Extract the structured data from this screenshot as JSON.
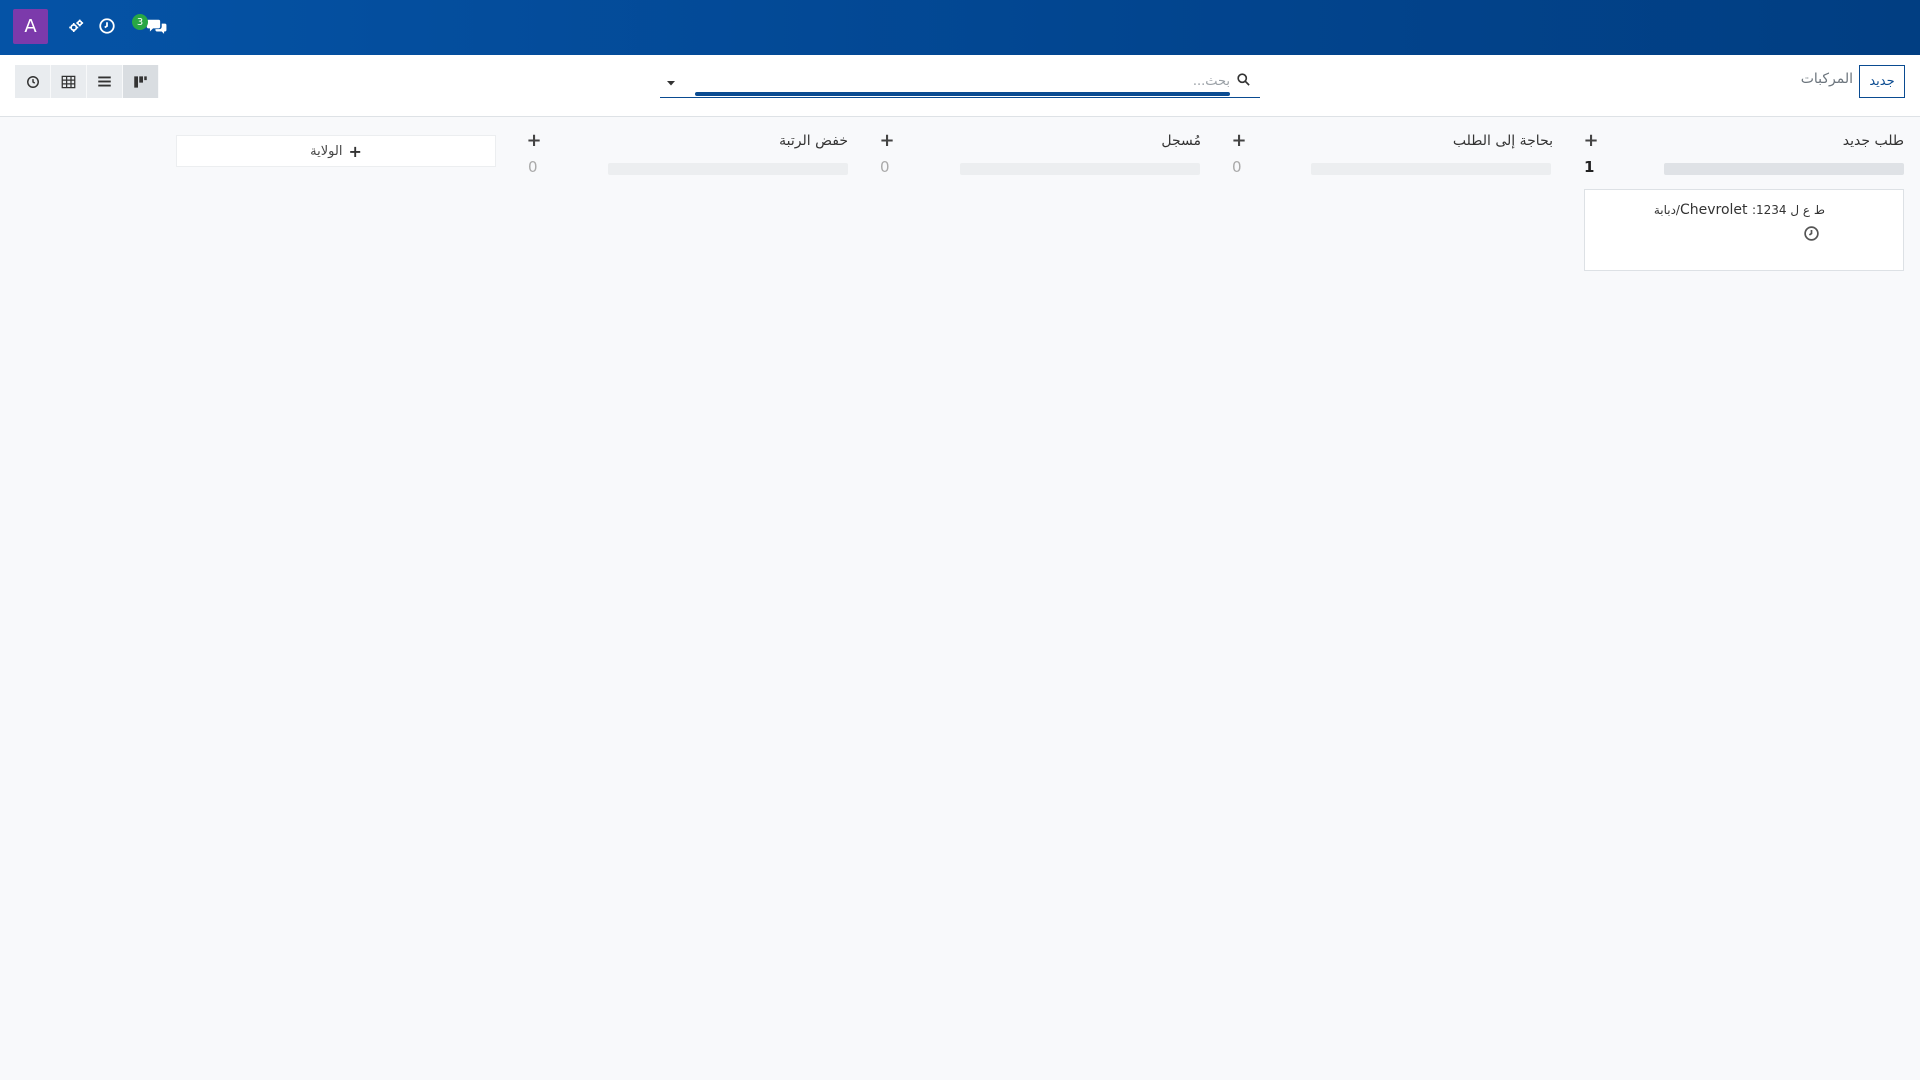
{
  "navbar": {
    "avatar_letter": "A",
    "messages_badge": "3",
    "icons": [
      "settings-gear-icon",
      "clock-icon",
      "chat-icon"
    ]
  },
  "control_panel": {
    "breadcrumb": "المركبات",
    "new_button": "جديد",
    "search_placeholder": "بحث...",
    "views": [
      "activity-view-icon",
      "pivot-view-icon",
      "list-view-icon",
      "kanban-view-icon"
    ]
  },
  "kanban": {
    "columns": [
      {
        "title": "طلب جديد",
        "count": "1"
      },
      {
        "title": "بحاجة إلى الطلب",
        "count": "0"
      },
      {
        "title": "مُسجل",
        "count": "0"
      },
      {
        "title": "خفض الرتبة",
        "count": "0"
      }
    ],
    "card": {
      "title_prefix": "ط ع ل 1234:",
      "title_model": "Chevrolet",
      "title_suffix": "/دبابة"
    },
    "add_column_label": "الولاية"
  },
  "colors": {
    "navbar": "#0553a6",
    "accent": "#0a4b91",
    "avatar": "#7c3aab",
    "badge": "#28a745"
  }
}
